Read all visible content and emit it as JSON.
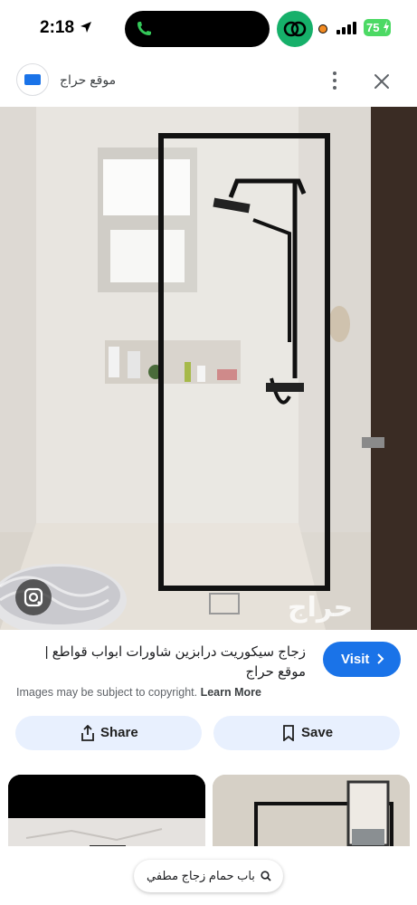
{
  "status_bar": {
    "time": "2:18",
    "battery": "75",
    "icons": [
      "location-arrow-icon",
      "phone-call-icon",
      "app-ring-icon",
      "recording-dot-icon",
      "signal-icon",
      "battery-icon"
    ]
  },
  "header": {
    "site_name": "موقع حراج",
    "logo_icon": "site-logo-icon",
    "more_icon": "more-vert-icon",
    "close_icon": "close-icon"
  },
  "image": {
    "watermark": "حراج",
    "lens_icon": "google-lens-icon"
  },
  "result": {
    "caption": "زجاج سيكوريت درابزين شاورات ابواب قواطع | موقع حراج",
    "visit_label": "Visit",
    "copyright_text": "Images may be subject to copyright.",
    "learn_more": "Learn More"
  },
  "actions": {
    "share_label": "Share",
    "save_label": "Save"
  },
  "search_chip": {
    "label": "باب حمام زجاج مطفي"
  },
  "colors": {
    "accent": "#1a73e8",
    "button_bg": "#e8f0fe",
    "battery": "#4cd964",
    "ring_app": "#16b06a"
  }
}
